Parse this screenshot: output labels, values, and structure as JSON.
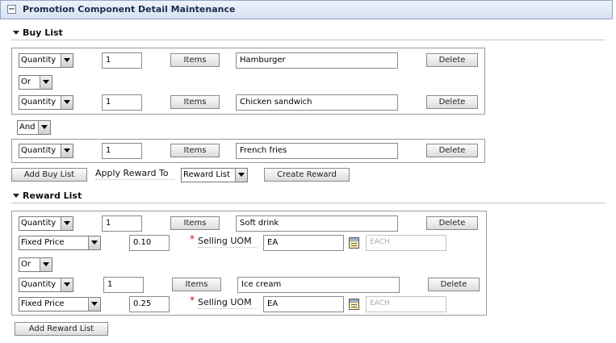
{
  "panel": {
    "title": "Promotion Component Detail Maintenance",
    "collapse_symbol": "−"
  },
  "buy_list": {
    "title": "Buy List",
    "rows": [
      {
        "type": "Quantity",
        "qty": "1",
        "items_label": "Items",
        "item": "Hamburger",
        "delete_label": "Delete"
      },
      {
        "type": "Quantity",
        "qty": "1",
        "items_label": "Items",
        "item": "Chicken sandwich",
        "delete_label": "Delete"
      },
      {
        "type": "Quantity",
        "qty": "1",
        "items_label": "Items",
        "item": "French fries",
        "delete_label": "Delete"
      }
    ],
    "inner_connector": "Or",
    "group_connector": "And",
    "add_label": "Add Buy List",
    "apply_reward_to_label": "Apply Reward To",
    "apply_reward_to_value": "Reward List",
    "create_reward_label": "Create Reward"
  },
  "reward_list": {
    "title": "Reward List",
    "rows": [
      {
        "type": "Quantity",
        "qty": "1",
        "items_label": "Items",
        "item": "Soft drink",
        "delete_label": "Delete",
        "price_type": "Fixed Price",
        "price": "0.10",
        "uom_label": "Selling UOM",
        "uom": "EA",
        "uom_desc": "EACH"
      },
      {
        "type": "Quantity",
        "qty": "1",
        "items_label": "Items",
        "item": "Ice cream",
        "delete_label": "Delete",
        "price_type": "Fixed Price",
        "price": "0.25",
        "uom_label": "Selling UOM",
        "uom": "EA",
        "uom_desc": "EACH"
      }
    ],
    "connector": "Or",
    "required_mark": "*",
    "add_label": "Add Reward List"
  },
  "icons": {
    "section_toggle": "triangle-down-icon",
    "lookup": "calendar-lookup-icon"
  },
  "colors": {
    "header_border": "#8fa6c4",
    "header_bg": "#dce6f3",
    "title_text": "#1b2d4a",
    "required": "#dd0000"
  }
}
